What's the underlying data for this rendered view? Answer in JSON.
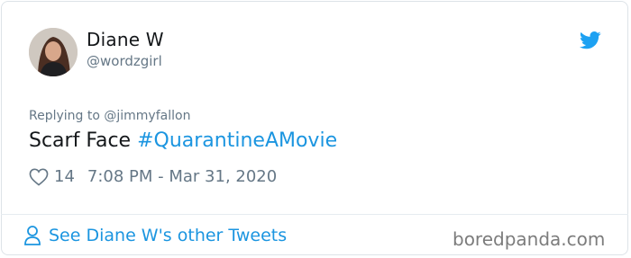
{
  "tweet": {
    "author_name": "Diane W",
    "author_handle": "@wordzgirl",
    "replying_to": "Replying to @jimmyfallon",
    "text": "Scarf Face",
    "hashtag": "#QuarantineAMovie",
    "likes": "14",
    "timestamp": "7:08 PM - Mar 31, 2020"
  },
  "footer": {
    "see_more_label": "See Diane W's other Tweets",
    "watermark": "boredpanda.com"
  },
  "icons": {
    "brand": "twitter-bird-icon",
    "like": "heart-icon",
    "profile": "person-icon"
  },
  "colors": {
    "link": "#1b95e0",
    "secondary_text": "#657786",
    "primary_text": "#14171a"
  }
}
